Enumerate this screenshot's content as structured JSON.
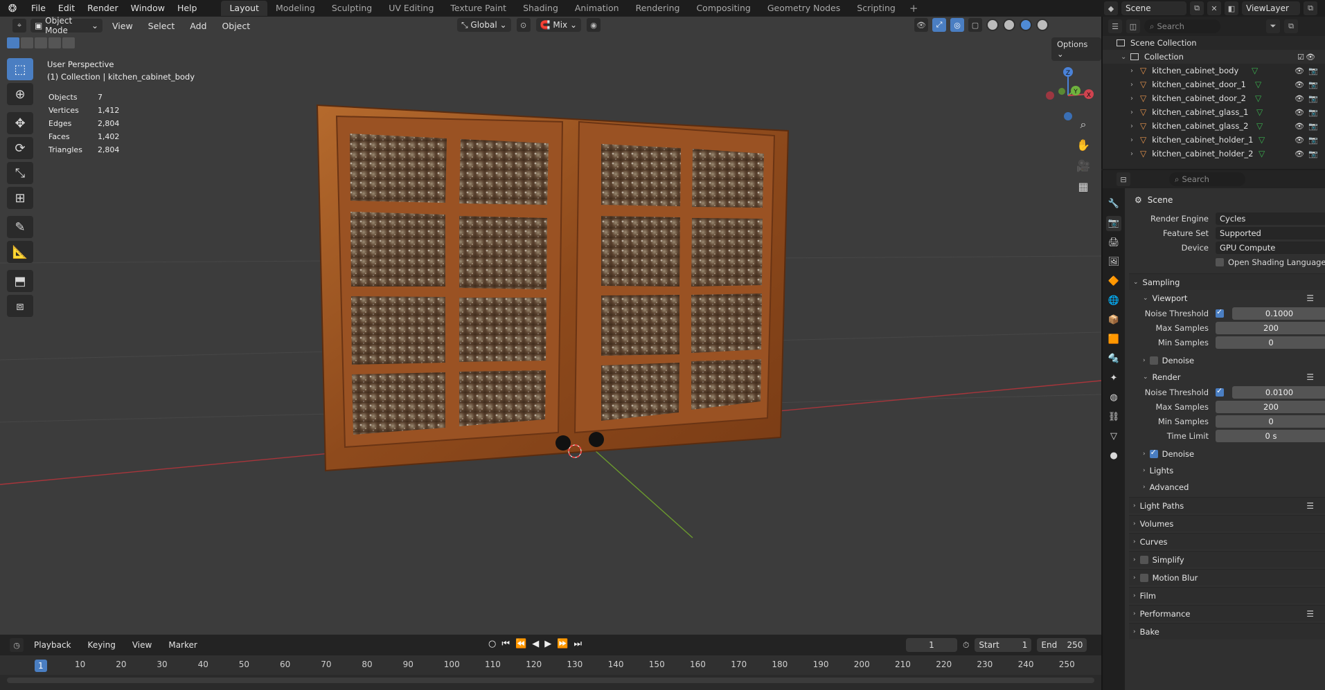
{
  "topbar": {
    "menus": [
      "File",
      "Edit",
      "Render",
      "Window",
      "Help"
    ],
    "workspaces": [
      "Layout",
      "Modeling",
      "Sculpting",
      "UV Editing",
      "Texture Paint",
      "Shading",
      "Animation",
      "Rendering",
      "Compositing",
      "Geometry Nodes",
      "Scripting"
    ],
    "active_workspace": "Layout",
    "add_tab": "+",
    "scene_name": "Scene",
    "view_layer": "ViewLayer"
  },
  "viewport": {
    "mode": "Object Mode",
    "menus": [
      "View",
      "Select",
      "Add",
      "Object"
    ],
    "transform_orientation": "Global",
    "pivot_label": "Mix",
    "options_label": "Options",
    "perspective_label": "User Perspective",
    "collection_label": "(1) Collection | kitchen_cabinet_body",
    "stats": [
      {
        "label": "Objects",
        "value": "7"
      },
      {
        "label": "Vertices",
        "value": "1,412"
      },
      {
        "label": "Edges",
        "value": "2,804"
      },
      {
        "label": "Faces",
        "value": "1,402"
      },
      {
        "label": "Triangles",
        "value": "2,804"
      }
    ],
    "gizmo": {
      "z": "Z",
      "y": "Y",
      "x": "X"
    }
  },
  "timeline": {
    "menus": [
      "Playback",
      "Keying",
      "View",
      "Marker"
    ],
    "current_frame": "1",
    "start_label": "Start",
    "start_value": "1",
    "end_label": "End",
    "end_value": "250",
    "ticks": [
      "10",
      "20",
      "30",
      "40",
      "50",
      "60",
      "70",
      "80",
      "90",
      "100",
      "110",
      "120",
      "130",
      "140",
      "150",
      "160",
      "170",
      "180",
      "190",
      "200",
      "210",
      "220",
      "230",
      "240",
      "250"
    ]
  },
  "outliner": {
    "search_placeholder": "Search",
    "scene_collection": "Scene Collection",
    "collection": "Collection",
    "objects": [
      "kitchen_cabinet_body",
      "kitchen_cabinet_door_1",
      "kitchen_cabinet_door_2",
      "kitchen_cabinet_glass_1",
      "kitchen_cabinet_glass_2",
      "kitchen_cabinet_holder_1",
      "kitchen_cabinet_holder_2"
    ]
  },
  "properties": {
    "search_placeholder": "Search",
    "context": "Scene",
    "render_engine_label": "Render Engine",
    "render_engine": "Cycles",
    "feature_set_label": "Feature Set",
    "feature_set": "Supported",
    "device_label": "Device",
    "device": "GPU Compute",
    "osl_label": "Open Shading Language",
    "sampling": "Sampling",
    "viewport_section": "Viewport",
    "vp_noise_label": "Noise Threshold",
    "vp_noise": "0.1000",
    "vp_max_label": "Max Samples",
    "vp_max": "200",
    "vp_min_label": "Min Samples",
    "vp_min": "0",
    "vp_denoise": "Denoise",
    "render_section": "Render",
    "r_noise_label": "Noise Threshold",
    "r_noise": "0.0100",
    "r_max_label": "Max Samples",
    "r_max": "200",
    "r_min_label": "Min Samples",
    "r_min": "0",
    "r_time_label": "Time Limit",
    "r_time": "0 s",
    "r_denoise": "Denoise",
    "lights": "Lights",
    "advanced": "Advanced",
    "light_paths": "Light Paths",
    "volumes": "Volumes",
    "curves": "Curves",
    "simplify": "Simplify",
    "motion_blur": "Motion Blur",
    "film": "Film",
    "performance": "Performance",
    "bake": "Bake"
  }
}
